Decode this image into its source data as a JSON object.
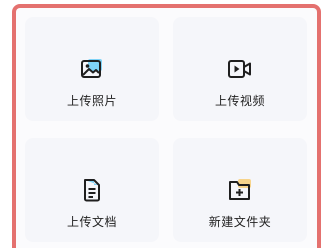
{
  "actions": [
    {
      "label": "上传照片",
      "icon": "image-icon"
    },
    {
      "label": "上传视频",
      "icon": "video-icon"
    },
    {
      "label": "上传文档",
      "icon": "document-icon"
    },
    {
      "label": "新建文件夹",
      "icon": "new-folder-icon"
    }
  ],
  "colors": {
    "frame_border": "#e4716f",
    "card_background": "#f5f6fa",
    "icon_stroke": "#1f1f1f",
    "icon_accent_blue": "#7fd3f7",
    "icon_accent_yellow": "#f7d48b"
  }
}
